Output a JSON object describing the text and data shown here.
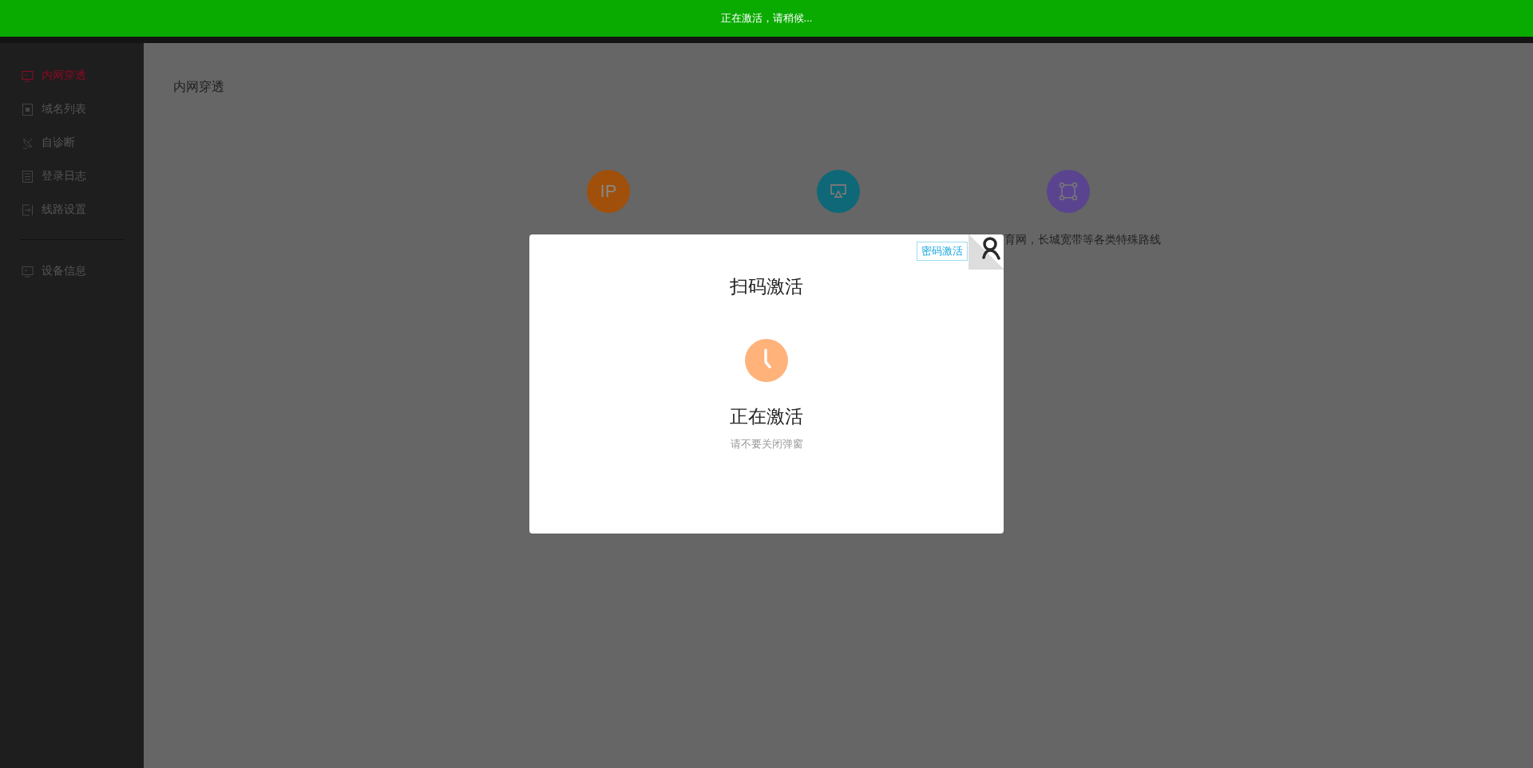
{
  "top_banner": {
    "message": "正在激活，请稍候..."
  },
  "sidebar": {
    "main_items": [
      {
        "label": "内网穿透",
        "selected": true
      },
      {
        "label": "域名列表",
        "selected": false
      },
      {
        "label": "自诊断",
        "selected": false
      },
      {
        "label": "登录日志",
        "selected": false
      },
      {
        "label": "线路设置",
        "selected": false
      }
    ],
    "bottom_items": [
      {
        "label": "设备信息",
        "selected": false
      }
    ]
  },
  "page": {
    "title": "内网穿透",
    "features": [
      {
        "kind": "ip",
        "icon_text": "IP",
        "color": "#a0500a"
      },
      {
        "kind": "screen",
        "color": "#0e6878"
      },
      {
        "kind": "nodes",
        "color": "#5a4490",
        "description": "育网，长城宽带等各类特殊路线"
      }
    ]
  },
  "dialog": {
    "tag_link": "密码激活",
    "title": "扫码激活",
    "status": "正在激活",
    "hint": "请不要关闭弹窗"
  }
}
